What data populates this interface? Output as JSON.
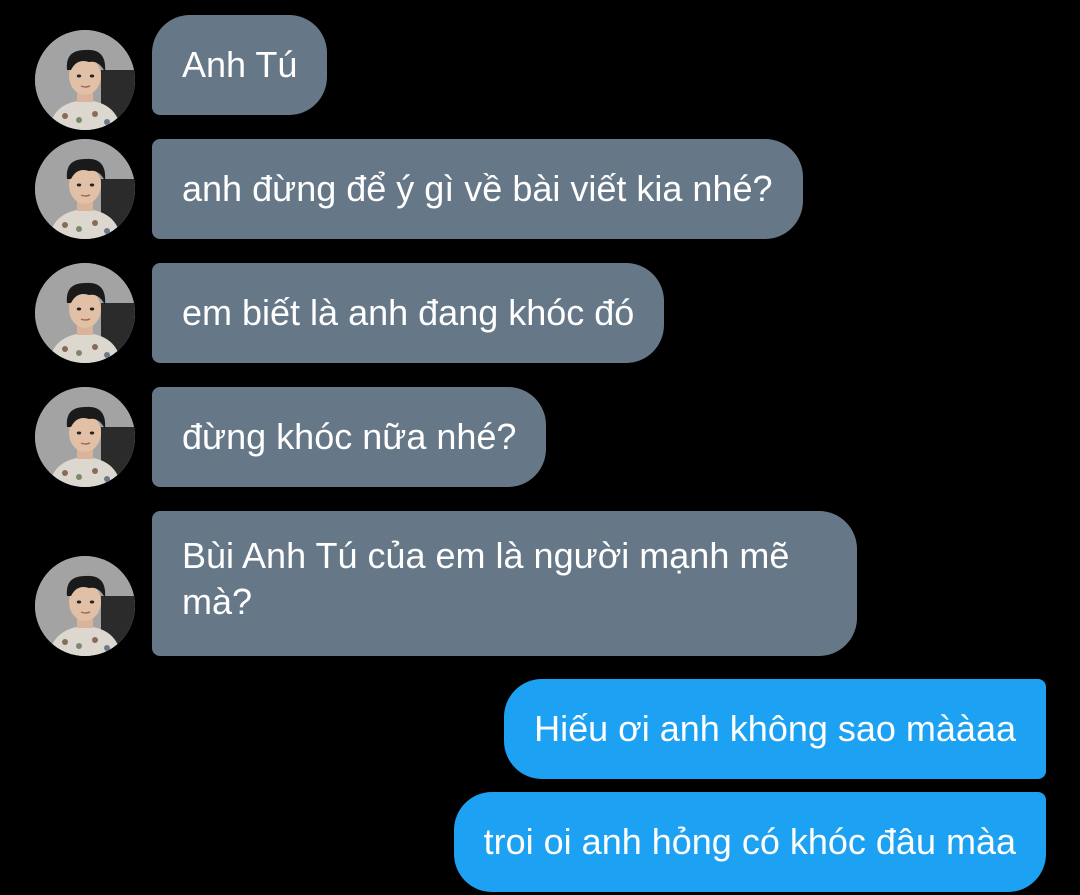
{
  "conversation": {
    "contact_avatar_icon": "contact-avatar-photo",
    "colors": {
      "background": "#000000",
      "incoming_bubble": "#667888",
      "outgoing_bubble": "#1da1f2",
      "text": "#ffffff"
    },
    "incoming": [
      {
        "text": "Anh Tú"
      },
      {
        "text": "anh đừng để ý gì về bài viết kia nhé?"
      },
      {
        "text": "em biết là anh đang khóc đó"
      },
      {
        "text": "đừng khóc nữa nhé?"
      },
      {
        "text": "Bùi Anh Tú của em là người mạnh mẽ mà?"
      }
    ],
    "outgoing": [
      {
        "text": "Hiếu ơi anh không sao mààaa"
      },
      {
        "text": "troi oi anh hỏng có khóc đâu màa"
      }
    ]
  }
}
